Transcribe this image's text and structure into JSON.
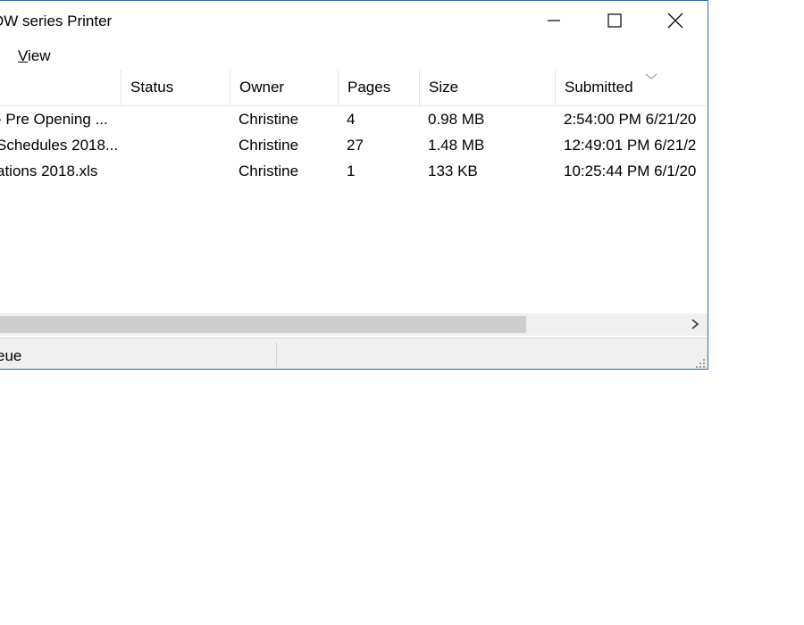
{
  "window": {
    "title": "DW series Printer"
  },
  "controls": {
    "minimize": "minimize-icon",
    "maximize": "maximize-icon",
    "close": "close-icon"
  },
  "menu": {
    "view_prefix": "V",
    "view_rest": "iew"
  },
  "columns": [
    "Status",
    "Owner",
    "Pages",
    "Size",
    "Submitted"
  ],
  "rows": [
    {
      "document": "- Pre Opening ...",
      "status": "",
      "owner": "Christine",
      "pages": "4",
      "size": "0.98 MB",
      "submitted": "2:54:00 PM  6/21/20"
    },
    {
      "document": "Schedules 2018...",
      "status": "",
      "owner": "Christine",
      "pages": "27",
      "size": "1.48 MB",
      "submitted": "12:49:01 PM  6/21/2"
    },
    {
      "document": "ations 2018.xls",
      "status": "",
      "owner": "Christine",
      "pages": "1",
      "size": "133 KB",
      "submitted": "10:25:44 PM  6/1/20"
    }
  ],
  "statusbar": {
    "text": "eue"
  },
  "colors": {
    "window_border": "#2b6cc4",
    "scroll_thumb": "#cdcdcd",
    "statusbar_bg": "#f0f0f0"
  }
}
